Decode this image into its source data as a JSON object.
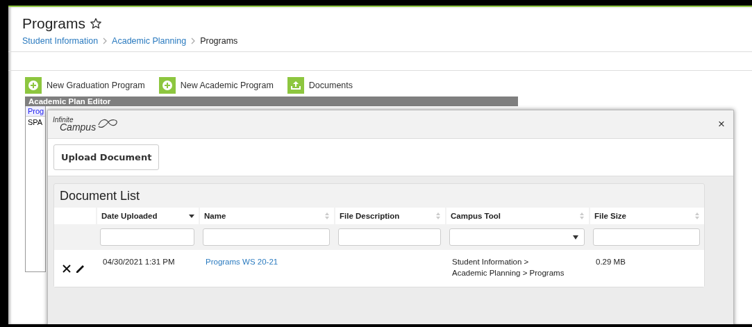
{
  "page": {
    "title": "Programs",
    "favorite": false,
    "breadcrumb": [
      {
        "label": "Student Information",
        "link": true
      },
      {
        "label": "Academic Planning",
        "link": true
      },
      {
        "label": "Programs",
        "link": false
      }
    ]
  },
  "toolbar": [
    {
      "label": "New Graduation Program",
      "kind": "add"
    },
    {
      "label": "New Academic Program",
      "kind": "add"
    },
    {
      "label": "Documents",
      "kind": "upload"
    }
  ],
  "editor": {
    "title": "Academic Plan Editor",
    "column_header": "Prog",
    "rows": [
      "SPA"
    ]
  },
  "modal": {
    "logo": [
      "Infinite",
      "Campus"
    ],
    "close": "×",
    "upload_button": "Upload Document",
    "document_list": {
      "title": "Document List",
      "columns": [
        {
          "label": "Date Uploaded",
          "sorted": true,
          "kind": "text"
        },
        {
          "label": "Name",
          "sorted": false,
          "kind": "text"
        },
        {
          "label": "File Description",
          "sorted": false,
          "kind": "text"
        },
        {
          "label": "Campus Tool",
          "sorted": false,
          "kind": "select"
        },
        {
          "label": "File Size",
          "sorted": false,
          "kind": "text"
        }
      ],
      "rows": [
        {
          "date_uploaded": "04/30/2021 1:31 PM",
          "name": "Programs WS 20-21",
          "campus_tool": [
            "Student Information >",
            "Academic Planning > Programs"
          ],
          "file_size": "0.29 MB"
        }
      ]
    }
  }
}
